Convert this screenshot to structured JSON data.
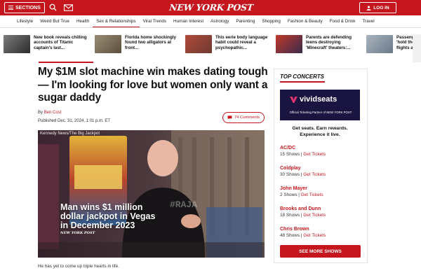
{
  "header": {
    "sections_label": "SECTIONS",
    "logo_text": "NEW YORK POST",
    "login_label": "LOG IN"
  },
  "nav": {
    "items": [
      "Lifestyle",
      "Weird But True",
      "Health",
      "Sex & Relationships",
      "Viral Trends",
      "Human Interest",
      "Astrology",
      "Parenting",
      "Shopping",
      "Fashion & Beauty",
      "Food & Drink",
      "Travel"
    ],
    "active": "Sex & Relationships"
  },
  "trending": [
    {
      "title": "New book reveals chilling accounts of Titanic captain's last..."
    },
    {
      "title": "Florida home shockingly found two alligators at front..."
    },
    {
      "title": "This eerie body language habit could reveal a psychopathic..."
    },
    {
      "title": "Parents are defending teens destroying 'Minecraft' theaters:..."
    },
    {
      "title": "Passengers 'hold the p flights a..."
    }
  ],
  "article": {
    "headline": "My $1M slot machine win makes dating tough — I'm looking for love but women only want a sugar daddy",
    "byline_prefix": "By",
    "author": "Ben Cost",
    "published": "Published Dec. 31, 2024, 1:01 p.m. ET",
    "comments_label": "74 Comments",
    "image_credit": "Kennedy News/The Big Jackpot",
    "image_caption": "Man wins $1 million dollar jackpot in Vegas in December 2023",
    "image_brand": "NEW YORK POST",
    "image_shirt_text": "#RAJA",
    "body_first": "He has yet to come up triple hearts in life."
  },
  "sidebar": {
    "title": "TOP CONCERTS",
    "partner_logo": "vividseats",
    "partner_sub": "Official Ticketing Partner of NEW YORK POST",
    "cta_line1": "Get seats. Earn rewards.",
    "cta_line2": "Experience it live.",
    "get_tickets_label": "Get Tickets",
    "concerts": [
      {
        "name": "AC/DC",
        "shows": "15 Shows"
      },
      {
        "name": "Coldplay",
        "shows": "30 Shows"
      },
      {
        "name": "John Mayer",
        "shows": "2 Shows"
      },
      {
        "name": "Brooks and Dunn",
        "shows": "18 Shows"
      },
      {
        "name": "Chris Brown",
        "shows": "48 Shows"
      }
    ],
    "see_more_label": "SEE MORE SHOWS"
  },
  "colors": {
    "brand_red": "#c4161c",
    "vivid_navy": "#1a1540"
  }
}
